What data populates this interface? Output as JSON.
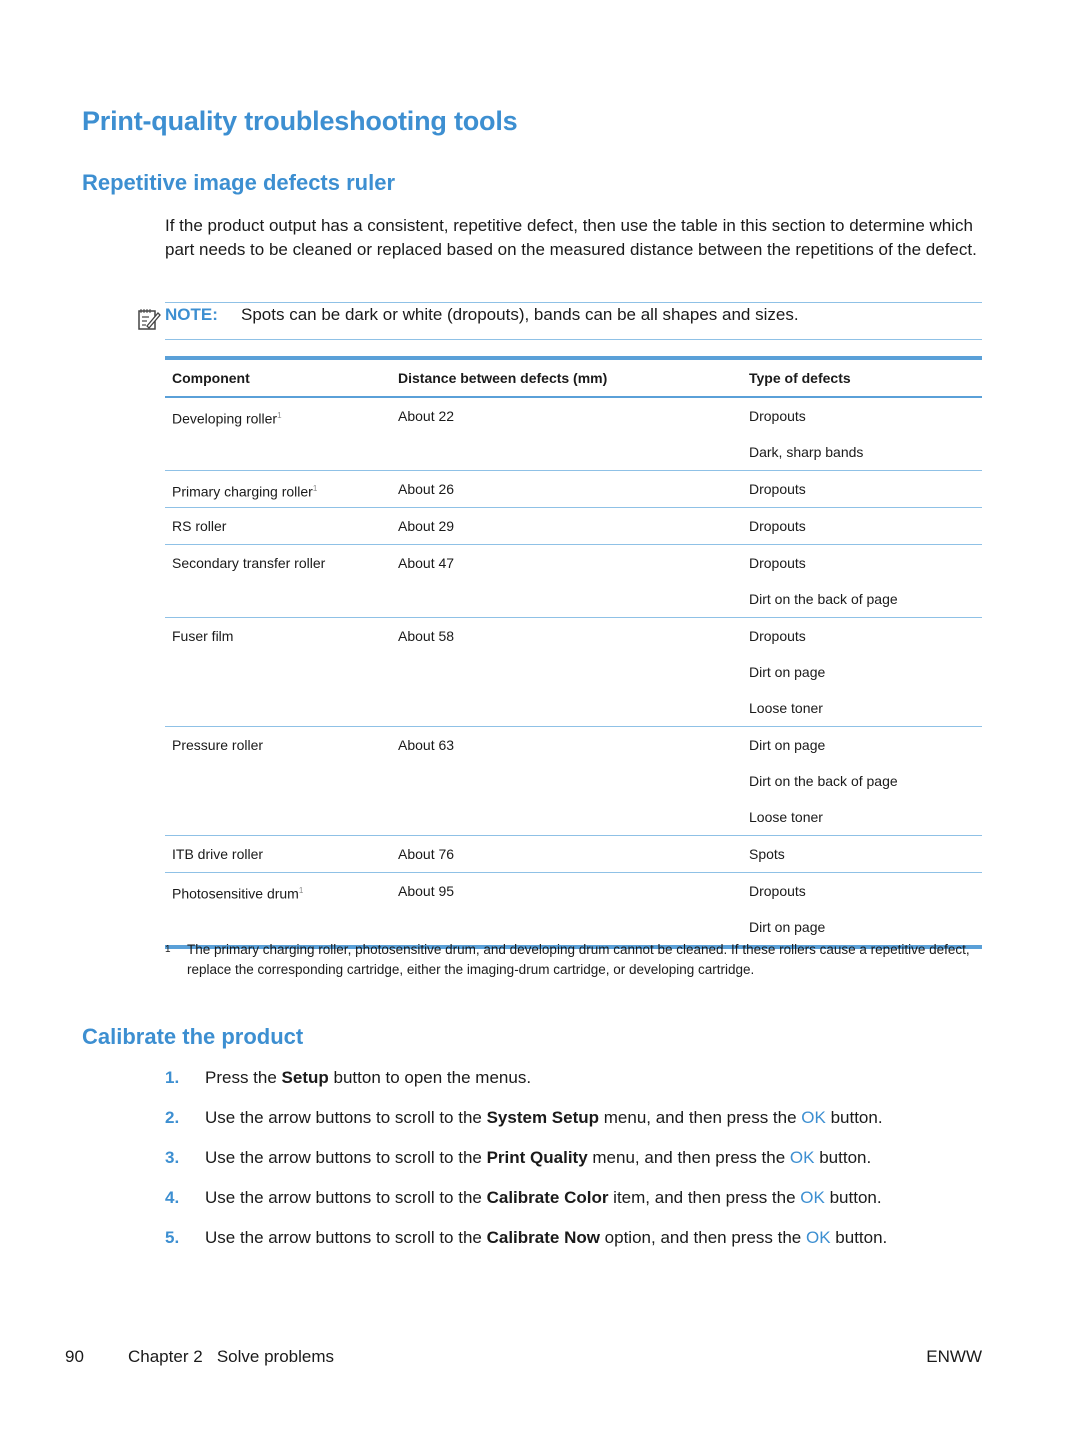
{
  "title": "Print-quality troubleshooting tools",
  "section1": {
    "heading": "Repetitive image defects ruler",
    "intro": "If the product output has a consistent, repetitive defect, then use the table in this section to determine which part needs to be cleaned or replaced based on the measured distance between the repetitions of the defect.",
    "note_label": "NOTE:",
    "note_text": "Spots can be dark or white (dropouts), bands can be all shapes and sizes."
  },
  "table": {
    "headers": [
      "Component",
      "Distance between defects (mm)",
      "Type of defects"
    ],
    "rows": [
      {
        "component": "Developing roller",
        "footnote": "1",
        "distance": "About 22",
        "defects": [
          "Dropouts",
          "Dark, sharp bands"
        ]
      },
      {
        "component": "Primary charging roller",
        "footnote": "1",
        "distance": "About 26",
        "defects": [
          "Dropouts"
        ]
      },
      {
        "component": "RS roller",
        "footnote": "",
        "distance": "About 29",
        "defects": [
          "Dropouts"
        ]
      },
      {
        "component": "Secondary transfer roller",
        "footnote": "",
        "distance": "About 47",
        "defects": [
          "Dropouts",
          "Dirt on the back of page"
        ]
      },
      {
        "component": "Fuser film",
        "footnote": "",
        "distance": "About 58",
        "defects": [
          "Dropouts",
          "Dirt on page",
          "Loose toner"
        ]
      },
      {
        "component": "Pressure roller",
        "footnote": "",
        "distance": "About 63",
        "defects": [
          "Dirt on page",
          "Dirt on the back of page",
          "Loose toner"
        ]
      },
      {
        "component": "ITB drive roller",
        "footnote": "",
        "distance": "About 76",
        "defects": [
          "Spots"
        ]
      },
      {
        "component": "Photosensitive drum",
        "footnote": "1",
        "distance": "About 95",
        "defects": [
          "Dropouts",
          "Dirt on page"
        ]
      }
    ],
    "footnote_mark": "1",
    "footnote_text": "The primary charging roller, photosensitive drum, and developing drum cannot be cleaned. If these rollers cause a repetitive defect, replace the corresponding cartridge, either the imaging-drum cartridge, or developing cartridge."
  },
  "section2": {
    "heading": "Calibrate the product",
    "steps": [
      {
        "num": "1.",
        "pre": "Press the ",
        "bold": "Setup",
        "post": " button to open the menus.",
        "ok": "",
        "tail": ""
      },
      {
        "num": "2.",
        "pre": "Use the arrow buttons to scroll to the ",
        "bold": "System Setup",
        "post": " menu, and then press the ",
        "ok": "OK",
        "tail": " button."
      },
      {
        "num": "3.",
        "pre": "Use the arrow buttons to scroll to the ",
        "bold": "Print Quality",
        "post": " menu, and then press the ",
        "ok": "OK",
        "tail": " button."
      },
      {
        "num": "4.",
        "pre": "Use the arrow buttons to scroll to the ",
        "bold": "Calibrate Color",
        "post": " item, and then press the ",
        "ok": "OK",
        "tail": " button."
      },
      {
        "num": "5.",
        "pre": "Use the arrow buttons to scroll to the ",
        "bold": "Calibrate Now",
        "post": " option, and then press the ",
        "ok": "OK",
        "tail": " button."
      }
    ]
  },
  "footer": {
    "page_number": "90",
    "chapter": "Chapter 2   Solve problems",
    "right": "ENWW"
  },
  "colors": {
    "accent": "#3d8fd1",
    "rule": "#5aa0d8"
  }
}
